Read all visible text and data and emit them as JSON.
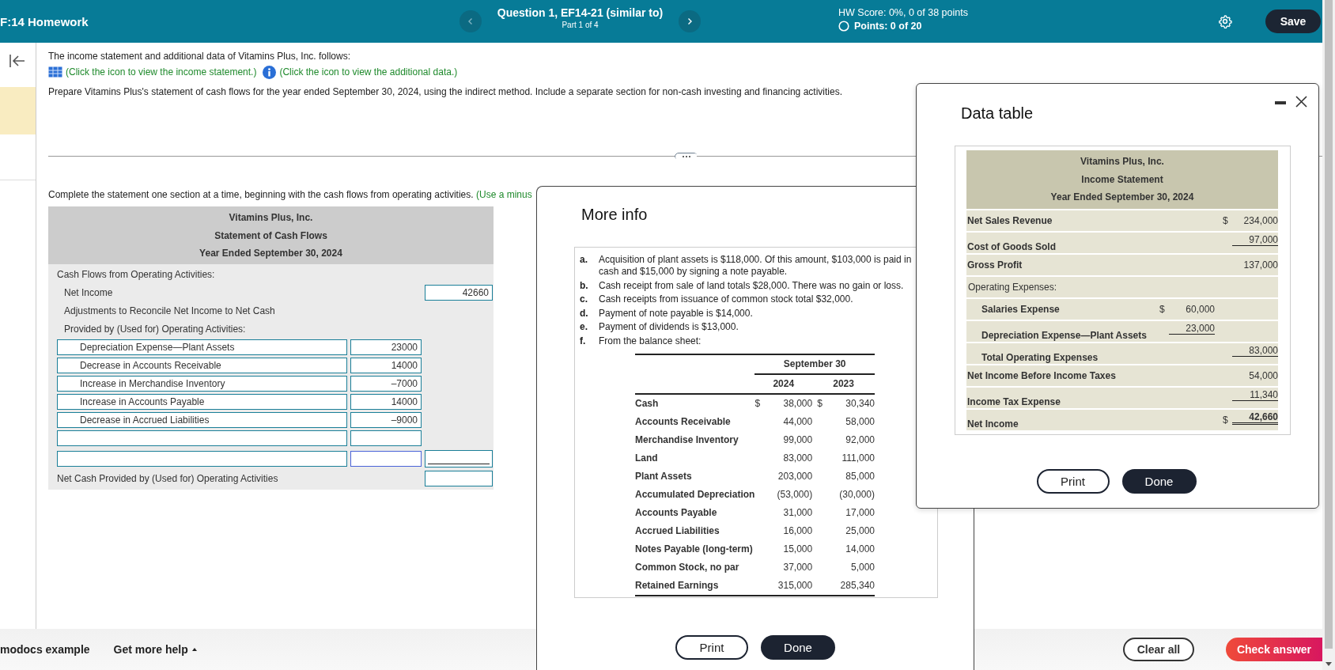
{
  "header": {
    "title": "F:14 Homework",
    "question_title": "Question 1, EF14-21 (similar to)",
    "part": "Part 1 of 4",
    "hw_score": "HW Score: 0%, 0 of 38 points",
    "points": "Points: 0 of 20",
    "save": "Save"
  },
  "question": {
    "intro": "The income statement and additional data of Vitamins Plus, Inc. follows:",
    "links": [
      {
        "kind": "table",
        "text": "(Click the icon to view the income statement.)"
      },
      {
        "kind": "info",
        "text": "(Click the icon to view the additional data.)"
      }
    ],
    "instruction": "Prepare Vitamins Plus's statement of cash flows for the year ended September 30, 2024, using the indirect method. Include a separate section for non-cash investing and financing activities.",
    "prompt": "Complete the statement one section at a time, beginning with the cash flows from operating activities.",
    "prompt_hint": "(Use a minus"
  },
  "statement": {
    "company": "Vitamins Plus, Inc.",
    "title": "Statement of Cash Flows",
    "period": "Year Ended September 30, 2024",
    "section": "Cash Flows from Operating Activities:",
    "net_income_label": "Net Income",
    "net_income_value": "42660",
    "adjustments_line_1": "Adjustments to Reconcile Net Income to Net Cash",
    "adjustments_line_2": "Provided by (Used for) Operating Activities:",
    "rows": [
      {
        "kind": "entry",
        "label": "Depreciation Expense—Plant Assets",
        "value": "23000",
        "focused": false
      },
      {
        "kind": "entry",
        "label": "Decrease in Accounts Receivable",
        "value": "14000",
        "focused": false
      },
      {
        "kind": "entry",
        "label": "Increase in Merchandise Inventory",
        "value": "–7000",
        "focused": false
      },
      {
        "kind": "entry",
        "label": "Increase in Accounts Payable",
        "value": "14000",
        "focused": false
      },
      {
        "kind": "entry",
        "label": "Decrease in Accrued Liabilities",
        "value": "–9000",
        "focused": false
      },
      {
        "kind": "blank",
        "focused": false
      },
      {
        "kind": "subtotal",
        "focused": true
      }
    ],
    "net_cash_label": "Net Cash Provided by (Used for) Operating Activities"
  },
  "more_info": {
    "title": "More info",
    "items": [
      {
        "letter": "a.",
        "text": "Acquisition of plant assets is $118,000. Of this amount, $103,000 is paid in cash and $15,000 by signing a note payable."
      },
      {
        "letter": "b.",
        "text": "Cash receipt from sale of land totals $28,000. There was no gain or loss."
      },
      {
        "letter": "c.",
        "text": "Cash receipts from issuance of common stock total $32,000."
      },
      {
        "letter": "d.",
        "text": "Payment of note payable is $14,000."
      },
      {
        "letter": "e.",
        "text": "Payment of dividends is $13,000."
      },
      {
        "letter": "f.",
        "text": "From the balance sheet:"
      }
    ],
    "balance": {
      "group_heading": "September 30",
      "years": [
        "2024",
        "2023"
      ],
      "rows": [
        {
          "label": "Cash",
          "sign": "$",
          "v2024": "38,000",
          "v2023": "30,340"
        },
        {
          "label": "Accounts Receivable",
          "v2024": "44,000",
          "v2023": "58,000"
        },
        {
          "label": "Merchandise Inventory",
          "v2024": "99,000",
          "v2023": "92,000"
        },
        {
          "label": "Land",
          "v2024": "83,000",
          "v2023": "111,000"
        },
        {
          "label": "Plant Assets",
          "v2024": "203,000",
          "v2023": "85,000"
        },
        {
          "label": "Accumulated Depreciation",
          "v2024": "(53,000)",
          "v2023": "(30,000)"
        },
        {
          "label": "Accounts Payable",
          "v2024": "31,000",
          "v2023": "17,000"
        },
        {
          "label": "Accrued Liabilities",
          "v2024": "16,000",
          "v2023": "25,000"
        },
        {
          "label": "Notes Payable (long-term)",
          "v2024": "15,000",
          "v2023": "14,000"
        },
        {
          "label": "Common Stock, no par",
          "v2024": "37,000",
          "v2023": "5,000"
        },
        {
          "label": "Retained Earnings",
          "v2024": "315,000",
          "v2023": "285,340"
        }
      ]
    },
    "buttons": [
      "Print",
      "Done"
    ]
  },
  "data_table": {
    "title": "Data table",
    "company": "Vitamins Plus, Inc.",
    "statement": "Income Statement",
    "period": "Year Ended September 30, 2024",
    "rows": [
      {
        "kind": "line",
        "indent": false,
        "label": "Net Sales Revenue",
        "outer_sign": "$",
        "outer": "234,000",
        "underlined": false
      },
      {
        "kind": "line",
        "indent": false,
        "label": "Cost of Goods Sold",
        "outer": "97,000",
        "underlined": true
      },
      {
        "kind": "line",
        "indent": false,
        "label": "Gross Profit",
        "outer": "137,000",
        "underlined": false
      },
      {
        "kind": "heading",
        "indent": false,
        "label": "Operating Expenses:",
        "underlined": false
      },
      {
        "kind": "line",
        "indent": true,
        "label": "Salaries Expense",
        "inner_sign": "$",
        "inner": "60,000",
        "underlined": false
      },
      {
        "kind": "line",
        "indent": true,
        "label": "Depreciation Expense—Plant Assets",
        "inner": "23,000",
        "underlined": true
      },
      {
        "kind": "line",
        "indent": true,
        "label": "Total Operating Expenses",
        "outer": "83,000",
        "underlined": true
      },
      {
        "kind": "line",
        "indent": false,
        "label": "Net Income Before Income Taxes",
        "outer": "54,000",
        "underlined": false
      },
      {
        "kind": "line",
        "indent": false,
        "label": "Income Tax Expense",
        "outer": "11,340",
        "underlined": true
      },
      {
        "kind": "total",
        "indent": false,
        "label": "Net Income",
        "outer_sign": "$",
        "outer": "42,660",
        "underlined": true
      }
    ],
    "buttons": [
      "Print",
      "Done"
    ]
  },
  "footer": {
    "example": "modocs example",
    "help": "Get more help",
    "clear": "Clear all",
    "check": "Check answer"
  }
}
